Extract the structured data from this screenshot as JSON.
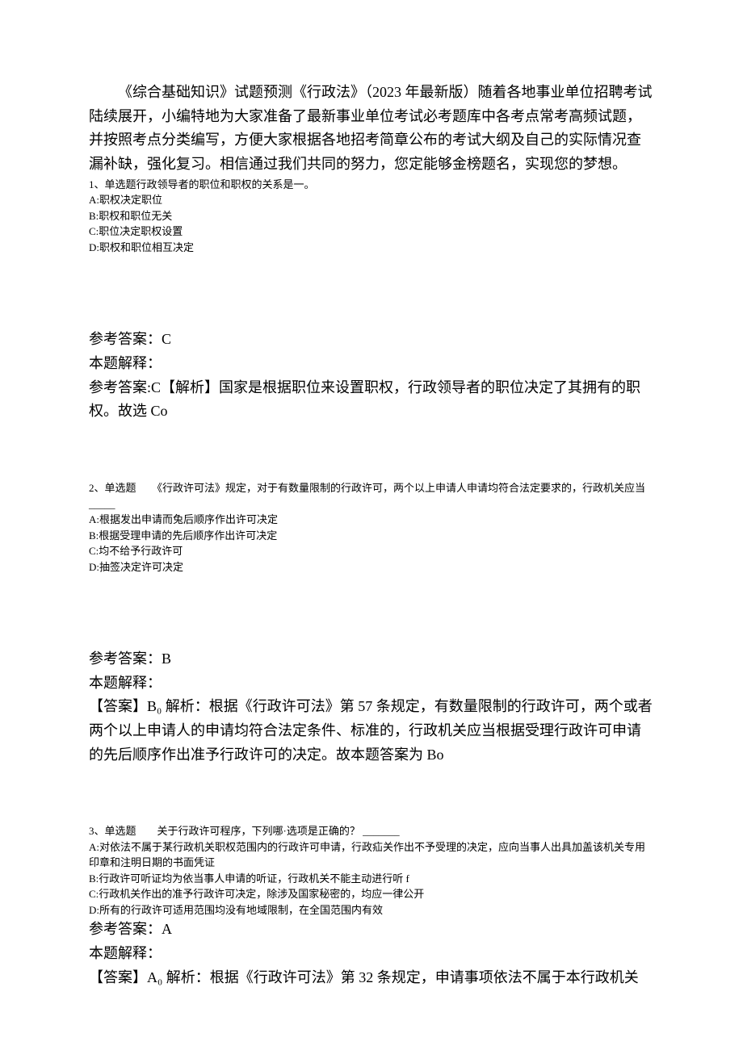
{
  "intro": "《综合基础知识》试题预测《行政法》（2023 年最新版）随着各地事业单位招聘考试陆续展开，小编特地为大家准备了最新事业单位考试必考题库中各考点常考高频试题，并按照考点分类编写，方便大家根据各地招考简章公布的考试大纲及自己的实际情况查漏补缺，强化复习。相信通过我们共同的努力，您定能够金榜题名，实现您的梦想。",
  "q1": {
    "stem": "1、单选题行政领导者的职位和职权的关系是一。",
    "A": "A:职权决定职位",
    "B": "B:职权和职位无关",
    "C": "C:职位决定职权设置",
    "D": "D:职权和职位相互决定",
    "ans": "参考答案：C",
    "exp_label": "本题解释：",
    "exp": "参考答案:C【解析】国家是根据职位来设置职权，行政领导者的职位决定了其拥有的职权。故选 Co"
  },
  "q2": {
    "stem": "2、单选题　　《行政许可法》规定，对于有数量限制的行政许可，两个以上申请人申请均符合法定要求的，行政机关应当 _____",
    "A": "A:根据发出申请而兔后顺序作出许可决定",
    "B": "B:根据受理申请的先后顺序作出许可决定",
    "C": "C:均不给予行政许可",
    "D": "D:抽签决定许可决定",
    "ans": "参考答案：B",
    "exp_label": "本题解释：",
    "exp": "【答案】B₀ 解析：根据《行政许可法》第 57 条规定，有数量限制的行政许可，两个或者两个以上申请人的申请均符合法定条件、标准的，行政机关应当根据受理行政许可申请的先后顺序作出准予行政许可的决定。故本题答案为 Bo"
  },
  "q3": {
    "stem": "3、单选题　　关于行政许可程序，下列哪·选项是正确的？ _______",
    "A": "A:对依法不属于某行政机关职权范围内的行政许可申请，行政疝关作出不予受理的决定，应向当事人出具加盖该机关专用印章和注明日期的书面凭证",
    "B": "B:行政许可听证均为依当事人申请的听证，行政机关不能主动进行听 f",
    "C": "C:行政机关作出的准予行政许可决定，除涉及国家秘密的，均应一律公开",
    "D": "D:所有的行政许可适用范围均没有地域限制，在全国范围内有效",
    "ans": "参考答案：A",
    "exp_label": "本题解释：",
    "exp": "【答案】A₀ 解析：根据《行政许可法》第 32 条规定，申请事项依法不属于本行政机关"
  }
}
